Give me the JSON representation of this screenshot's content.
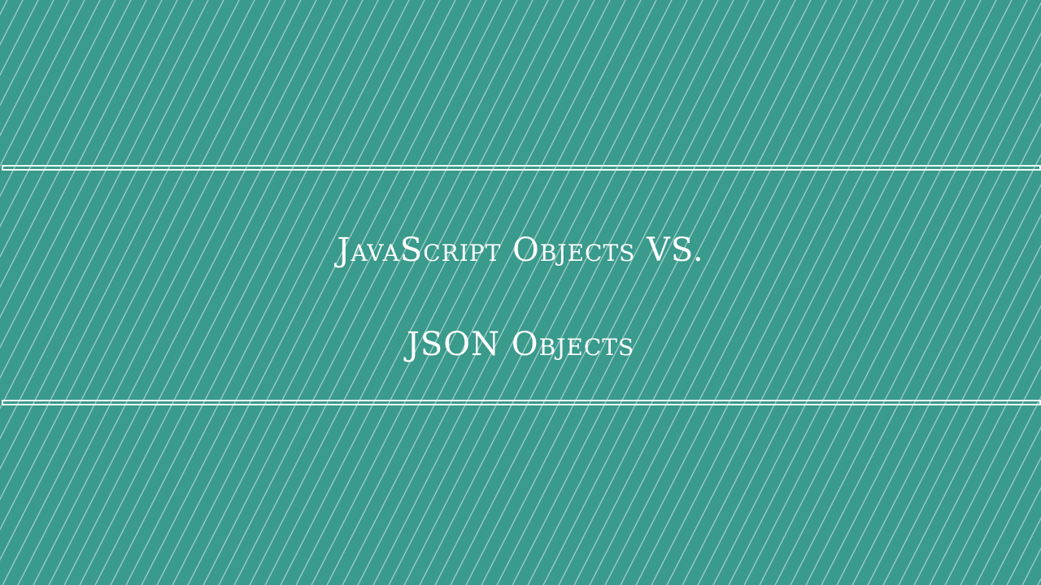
{
  "banner": {
    "title_line_1": "JavaScript Objects VS.",
    "title_line_2": "JSON Objects"
  },
  "colors": {
    "background": "#3a9a8c",
    "stripe": "#ffffff",
    "text": "#ffffff",
    "rule": "#f4faf8"
  }
}
